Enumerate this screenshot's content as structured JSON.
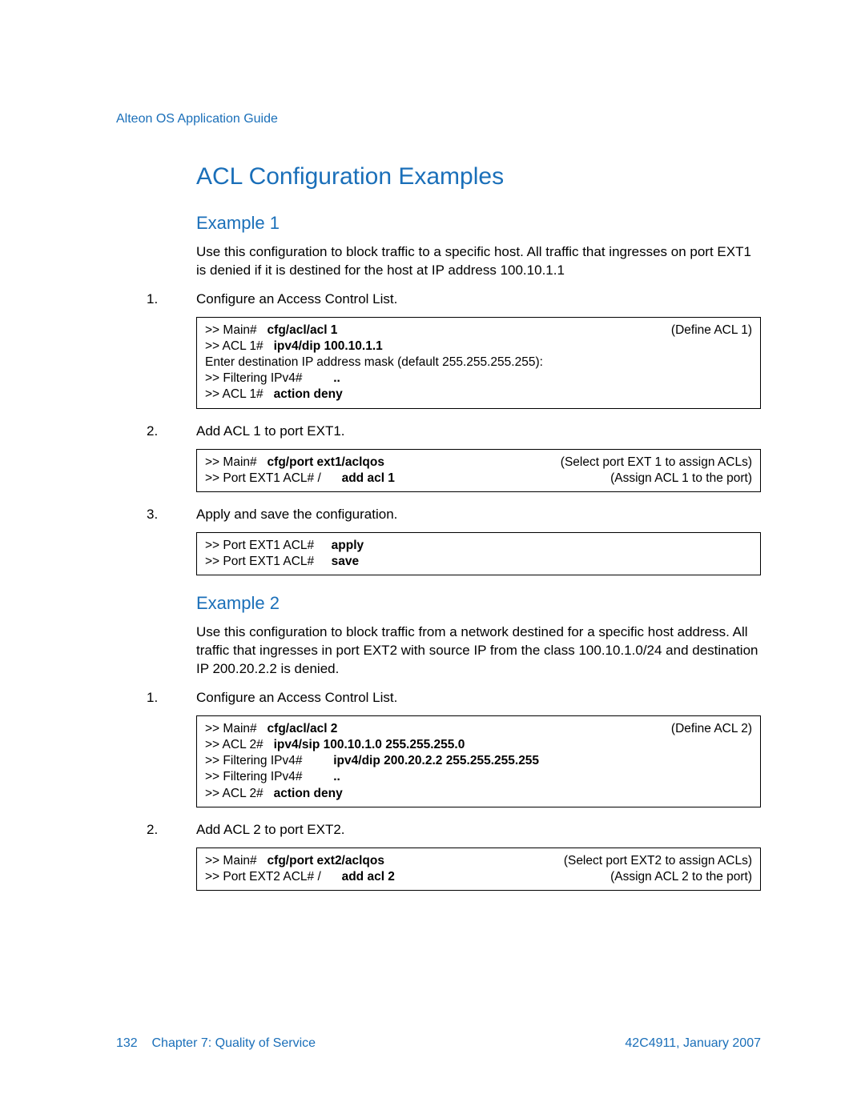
{
  "runningHeader": "Alteon OS Application Guide",
  "h1": "ACL Configuration Examples",
  "example1": {
    "title": "Example 1",
    "intro": "Use this configuration to block traffic to a specific host. All traffic that ingresses on port EXT1 is denied if it is destined for the host at IP address 100.10.1.1",
    "step1": {
      "num": "1.",
      "text": "Configure an Access Control List."
    },
    "code1": {
      "l1_prompt": ">> Main#   ",
      "l1_cmd": "cfg/acl/acl 1",
      "l1_note": "(Define ACL 1)",
      "l2_prompt": ">> ACL 1#   ",
      "l2_cmd": "ipv4/dip 100.10.1.1",
      "l3": "Enter destination IP address mask (default 255.255.255.255):",
      "l4_prompt": ">> Filtering IPv4#         ",
      "l4_cmd": "..",
      "l5_prompt": ">> ACL 1#   ",
      "l5_cmd": "action deny"
    },
    "step2": {
      "num": "2.",
      "text": "Add ACL 1 to port EXT1."
    },
    "code2": {
      "l1_prompt": ">> Main#   ",
      "l1_cmd": "cfg/port ext1/aclqos",
      "l1_note": "(Select port EXT 1 to assign ACLs)",
      "l2_prompt": ">> Port EXT1 ACL# /      ",
      "l2_cmd": "add acl 1",
      "l2_note": "(Assign ACL 1 to the port)"
    },
    "step3": {
      "num": "3.",
      "text": "Apply and save the configuration."
    },
    "code3": {
      "l1_prompt": ">> Port EXT1 ACL#     ",
      "l1_cmd": "apply",
      "l2_prompt": ">> Port EXT1 ACL#     ",
      "l2_cmd": "save"
    }
  },
  "example2": {
    "title": "Example 2",
    "intro": "Use this configuration to block traffic from a network destined for a specific host address. All traffic that ingresses in port EXT2 with source IP from the class 100.10.1.0/24 and destination IP 200.20.2.2 is denied.",
    "step1": {
      "num": "1.",
      "text": "Configure an Access Control List."
    },
    "code1": {
      "l1_prompt": ">> Main#   ",
      "l1_cmd": "cfg/acl/acl 2",
      "l1_note": "(Define ACL 2)",
      "l2_prompt": ">> ACL 2#   ",
      "l2_cmd": "ipv4/sip 100.10.1.0 255.255.255.0",
      "l3_prompt": ">> Filtering IPv4#         ",
      "l3_cmd": "ipv4/dip 200.20.2.2 255.255.255.255",
      "l4_prompt": ">> Filtering IPv4#         ",
      "l4_cmd": "..",
      "l5_prompt": ">> ACL 2#   ",
      "l5_cmd": "action deny"
    },
    "step2": {
      "num": "2.",
      "text": "Add ACL 2 to port EXT2."
    },
    "code2": {
      "l1_prompt": ">> Main#   ",
      "l1_cmd": "cfg/port ext2/aclqos",
      "l1_note": "(Select port EXT2 to assign ACLs)",
      "l2_prompt": ">> Port EXT2 ACL# /      ",
      "l2_cmd": "add acl 2",
      "l2_note": "(Assign ACL 2 to the port)"
    }
  },
  "footer": {
    "pageNum": "132",
    "chapter": "Chapter 7: Quality of Service",
    "docId": "42C4911, January 2007"
  }
}
